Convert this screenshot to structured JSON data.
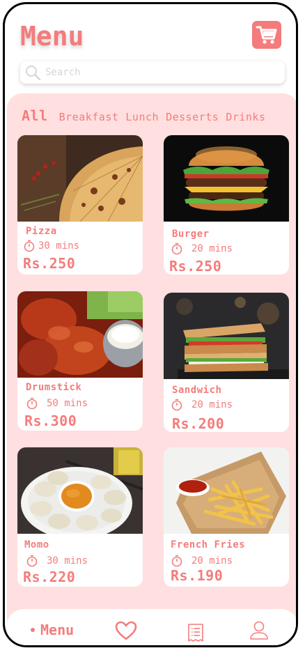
{
  "header": {
    "title": "Menu",
    "cart_icon": "cart-icon"
  },
  "search": {
    "placeholder": "Search",
    "value": ""
  },
  "categories": [
    "All",
    "Breakfast",
    "Lunch",
    "Desserts",
    "Drinks"
  ],
  "items": [
    {
      "name": "Pizza",
      "time": "30 mins",
      "price": "Rs.250",
      "image": "pizza-image"
    },
    {
      "name": "Burger",
      "time": "20 mins",
      "price": "Rs.250",
      "image": "burger-image"
    },
    {
      "name": "Drumstick",
      "time": "50 mins",
      "price": "Rs.300",
      "image": "drumstick-image"
    },
    {
      "name": "Sandwich",
      "time": "20 mins",
      "price": "Rs.200",
      "image": "sandwich-image"
    },
    {
      "name": "Momo",
      "time": "30 mins",
      "price": "Rs.220",
      "image": "momo-image"
    },
    {
      "name": "French Fries",
      "time": "20 mins",
      "price": "Rs.190",
      "image": "french-fries-image"
    }
  ],
  "bottom_nav": {
    "menu_label": "Menu",
    "icons": [
      "heart-icon",
      "receipt-icon",
      "profile-icon"
    ]
  },
  "colors": {
    "accent": "#f47c7c",
    "panel": "#ffdfe0"
  }
}
